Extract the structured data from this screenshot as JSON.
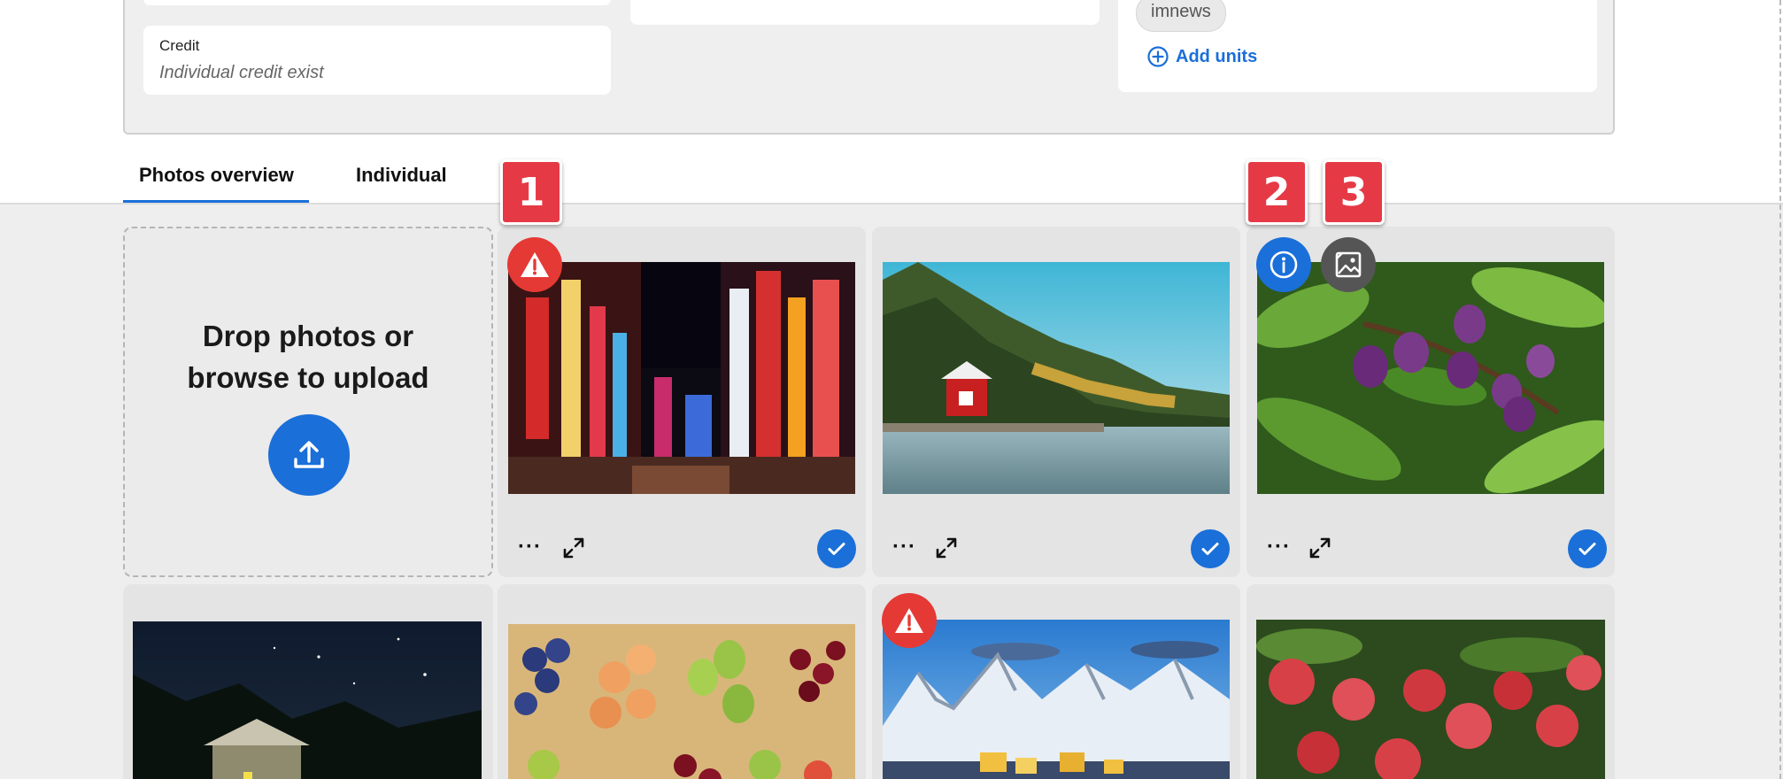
{
  "details": {
    "credit_label": "Credit",
    "credit_value": "Individual credit exist",
    "unit_chip": "imnews",
    "add_units_label": "Add units"
  },
  "tabs": [
    {
      "label": "Photos overview",
      "active": true
    },
    {
      "label": "Individual",
      "active": false
    }
  ],
  "upload": {
    "line1": "Drop photos or",
    "line2": "browse to upload",
    "icon": "upload-icon"
  },
  "card_actions": {
    "more": "···",
    "expand_icon": "expand-icon",
    "selected_icon": "check-icon"
  },
  "badges": {
    "warning_icon": "warning-icon",
    "info_icon": "info-icon",
    "image_icon": "image-edit-icon"
  },
  "markers": [
    "1",
    "2",
    "3"
  ],
  "photos": [
    {
      "subject": "neon-city-street",
      "warning": true,
      "selected": true
    },
    {
      "subject": "red-cabin-by-lake",
      "warning": false,
      "selected": true
    },
    {
      "subject": "purple-plums-on-branch",
      "warning": false,
      "selected": true,
      "info": true,
      "image_action": true
    },
    {
      "subject": "night-sky-cabin",
      "warning": false
    },
    {
      "subject": "fruit-baskets",
      "warning": false
    },
    {
      "subject": "snowy-mountain-village",
      "warning": true
    },
    {
      "subject": "red-apples-on-tree",
      "warning": false
    }
  ],
  "colors": {
    "accent": "#1a6fd9",
    "warning": "#e53935",
    "marker": "#e63946"
  }
}
